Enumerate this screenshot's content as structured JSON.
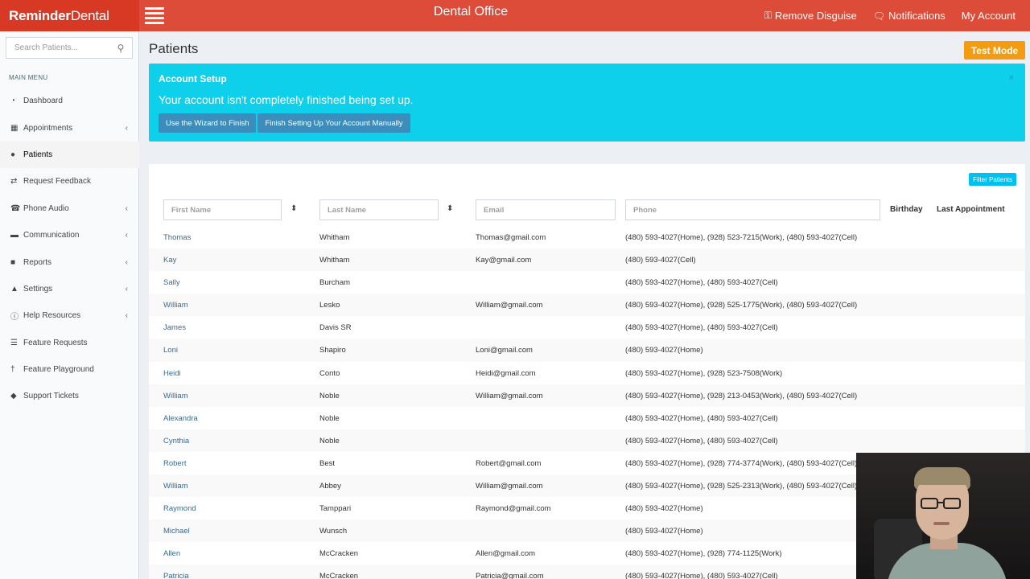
{
  "header": {
    "brand_bold": "Reminder",
    "brand_light": "Dental",
    "office_title": "Dental Office",
    "actions": [
      {
        "label": "Remove Disguise",
        "icon": "user-secret-icon"
      },
      {
        "label": "Notifications",
        "icon": "comments-icon"
      },
      {
        "label": "My Account",
        "icon": ""
      }
    ]
  },
  "sidebar": {
    "search_placeholder": "Search Patients...",
    "menu_header": "MAIN MENU",
    "items": [
      {
        "label": "Dashboard",
        "icon": "dashboard-icon",
        "expandable": false,
        "active": false
      },
      {
        "label": "Appointments",
        "icon": "calendar-icon",
        "expandable": true,
        "active": false
      },
      {
        "label": "Patients",
        "icon": "users-icon",
        "expandable": false,
        "active": true
      },
      {
        "label": "Request Feedback",
        "icon": "retweet-icon",
        "expandable": false,
        "active": false
      },
      {
        "label": "Phone Audio",
        "icon": "phone-icon",
        "expandable": true,
        "active": false
      },
      {
        "label": "Communication",
        "icon": "comments-icon",
        "expandable": true,
        "active": false
      },
      {
        "label": "Reports",
        "icon": "book-icon",
        "expandable": true,
        "active": false
      },
      {
        "label": "Settings",
        "icon": "user-icon",
        "expandable": true,
        "active": false
      },
      {
        "label": "Help Resources",
        "icon": "info-icon",
        "expandable": true,
        "active": false
      },
      {
        "label": "Feature Requests",
        "icon": "list-icon",
        "expandable": false,
        "active": false
      },
      {
        "label": "Feature Playground",
        "icon": "child-icon",
        "expandable": false,
        "active": false
      },
      {
        "label": "Support Tickets",
        "icon": "ticket-icon",
        "expandable": false,
        "active": false
      }
    ]
  },
  "page": {
    "title": "Patients",
    "test_mode": "Test Mode"
  },
  "alert": {
    "title": "Account Setup",
    "message": "Your account isn't completely finished being set up.",
    "close": "×",
    "wizard_button": "Use the Wizard to Finish",
    "manual_button": "Finish Setting Up Your Account Manually"
  },
  "table": {
    "filter_button": "Filter Patients",
    "filters": {
      "first_name": "First Name",
      "last_name": "Last Name",
      "email": "Email",
      "phone": "Phone"
    },
    "columns": {
      "birthday": "Birthday",
      "last_appointment": "Last Appointment"
    },
    "rows": [
      {
        "first": "Thomas",
        "last": "Whitham",
        "email": "Thomas@gmail.com",
        "phone": "(480) 593-4027(Home), (928) 523-7215(Work), (480) 593-4027(Cell)"
      },
      {
        "first": "Kay",
        "last": "Whitham",
        "email": "Kay@gmail.com",
        "phone": "(480) 593-4027(Cell)"
      },
      {
        "first": "Sally",
        "last": "Burcham",
        "email": "",
        "phone": "(480) 593-4027(Home), (480) 593-4027(Cell)"
      },
      {
        "first": "William",
        "last": "Lesko",
        "email": "William@gmail.com",
        "phone": "(480) 593-4027(Home), (928) 525-1775(Work), (480) 593-4027(Cell)"
      },
      {
        "first": "James",
        "last": "Davis SR",
        "email": "",
        "phone": "(480) 593-4027(Home), (480) 593-4027(Cell)"
      },
      {
        "first": "Loni",
        "last": "Shapiro",
        "email": "Loni@gmail.com",
        "phone": "(480) 593-4027(Home)"
      },
      {
        "first": "Heidi",
        "last": "Conto",
        "email": "Heidi@gmail.com",
        "phone": "(480) 593-4027(Home), (928) 523-7508(Work)"
      },
      {
        "first": "William",
        "last": "Noble",
        "email": "William@gmail.com",
        "phone": "(480) 593-4027(Home), (928) 213-0453(Work), (480) 593-4027(Cell)"
      },
      {
        "first": "Alexandra",
        "last": "Noble",
        "email": "",
        "phone": "(480) 593-4027(Home), (480) 593-4027(Cell)"
      },
      {
        "first": "Cynthia",
        "last": "Noble",
        "email": "",
        "phone": "(480) 593-4027(Home), (480) 593-4027(Cell)"
      },
      {
        "first": "Robert",
        "last": "Best",
        "email": "Robert@gmail.com",
        "phone": "(480) 593-4027(Home), (928) 774-3774(Work), (480) 593-4027(Cell)"
      },
      {
        "first": "William",
        "last": "Abbey",
        "email": "William@gmail.com",
        "phone": "(480) 593-4027(Home), (928) 525-2313(Work), (480) 593-4027(Cell)"
      },
      {
        "first": "Raymond",
        "last": "Tamppari",
        "email": "Raymond@gmail.com",
        "phone": "(480) 593-4027(Home)"
      },
      {
        "first": "Michael",
        "last": "Wunsch",
        "email": "",
        "phone": "(480) 593-4027(Home)"
      },
      {
        "first": "Allen",
        "last": "McCracken",
        "email": "Allen@gmail.com",
        "phone": "(480) 593-4027(Home), (928) 774-1125(Work)"
      },
      {
        "first": "Patricia",
        "last": "McCracken",
        "email": "Patricia@gmail.com",
        "phone": "(480) 593-4027(Home), (480) 593-4027(Cell)"
      }
    ]
  },
  "colors": {
    "header": "#dd4b39",
    "brand_bg": "#d73925",
    "alert": "#0ed0ea",
    "test_mode": "#f39c12",
    "alert_button": "#3c8dbc",
    "filter_button": "#00c0ef"
  }
}
